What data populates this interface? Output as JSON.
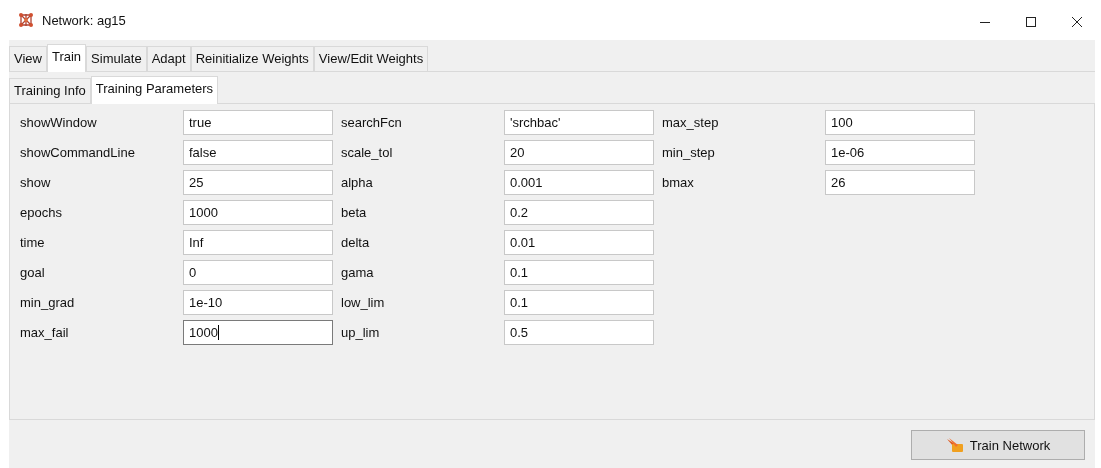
{
  "window": {
    "title": "Network: ag15"
  },
  "tabs": [
    {
      "label": "View",
      "selected": false
    },
    {
      "label": "Train",
      "selected": true
    },
    {
      "label": "Simulate",
      "selected": false
    },
    {
      "label": "Adapt",
      "selected": false
    },
    {
      "label": "Reinitialize Weights",
      "selected": false
    },
    {
      "label": "View/Edit Weights",
      "selected": false
    }
  ],
  "subtabs": [
    {
      "label": "Training Info",
      "selected": false
    },
    {
      "label": "Training Parameters",
      "selected": true
    }
  ],
  "parameter_columns": [
    [
      {
        "name": "showWindow",
        "value": "true",
        "focused": false
      },
      {
        "name": "showCommandLine",
        "value": "false",
        "focused": false
      },
      {
        "name": "show",
        "value": "25",
        "focused": false
      },
      {
        "name": "epochs",
        "value": "1000",
        "focused": false
      },
      {
        "name": "time",
        "value": "Inf",
        "focused": false
      },
      {
        "name": "goal",
        "value": "0",
        "focused": false
      },
      {
        "name": "min_grad",
        "value": "1e-10",
        "focused": false
      },
      {
        "name": "max_fail",
        "value": "1000",
        "focused": true
      }
    ],
    [
      {
        "name": "searchFcn",
        "value": "'srchbac'",
        "focused": false
      },
      {
        "name": "scale_tol",
        "value": "20",
        "focused": false
      },
      {
        "name": "alpha",
        "value": "0.001",
        "focused": false
      },
      {
        "name": "beta",
        "value": "0.2",
        "focused": false
      },
      {
        "name": "delta",
        "value": "0.01",
        "focused": false
      },
      {
        "name": "gama",
        "value": "0.1",
        "focused": false
      },
      {
        "name": "low_lim",
        "value": "0.1",
        "focused": false
      },
      {
        "name": "up_lim",
        "value": "0.5",
        "focused": false
      }
    ],
    [
      {
        "name": "max_step",
        "value": "100",
        "focused": false
      },
      {
        "name": "min_step",
        "value": "1e-06",
        "focused": false
      },
      {
        "name": "bmax",
        "value": "26",
        "focused": false
      }
    ]
  ],
  "train_button": {
    "label": "Train Network"
  }
}
